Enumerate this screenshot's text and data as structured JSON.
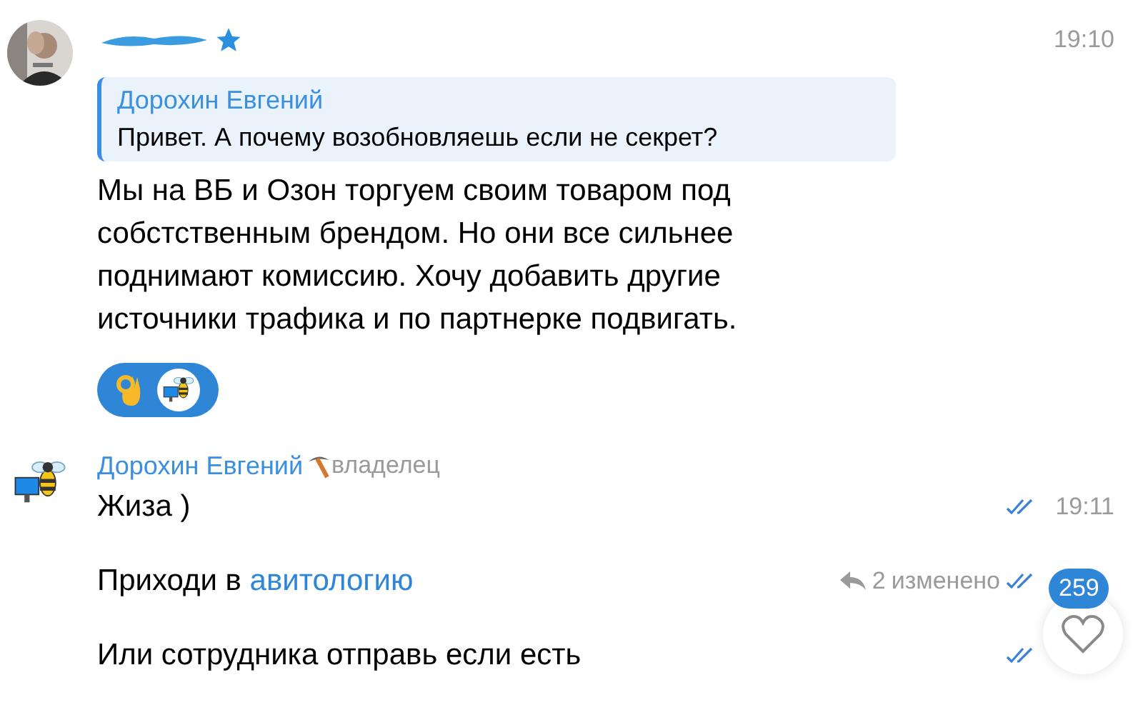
{
  "messages": [
    {
      "name_hidden": true,
      "starred": true,
      "time": "19:10",
      "reply": {
        "author": "Дорохин Евгений",
        "text": "Привет. А почему возобновляешь если не секрет?"
      },
      "text": "Мы на ВБ и Озон торгуем своим товаром под\nсобстственным брендом. Но они все сильнее\nподнимают комиссию. Хочу добавить другие\nисточники трафика и по партнерке подвигать.",
      "reactions": {
        "selected": true,
        "items": [
          {
            "kind": "emoji"
          },
          {
            "kind": "avatar"
          }
        ]
      }
    },
    {
      "author": "Дорохин Евгений",
      "role": "владелец",
      "lines": [
        {
          "text": "Жиза )",
          "time": "19:11",
          "read": true
        },
        {
          "text": "Приходи в ",
          "link": "авитологию",
          "replies": "2",
          "edited": "изменено",
          "read": true
        },
        {
          "text": "Или сотрудника отправь если есть",
          "read": true
        }
      ]
    }
  ],
  "unread_badge": "259"
}
